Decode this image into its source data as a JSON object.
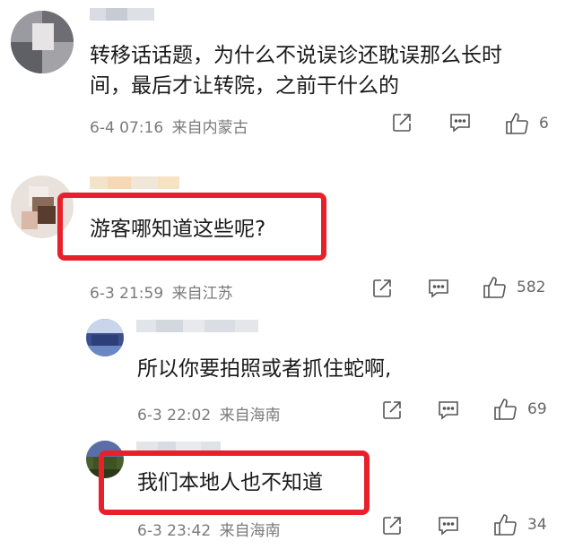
{
  "comments": [
    {
      "text_lines": [
        "转移话话题，为什么不说误诊还耽误那么长时",
        "间，最后才让转院，之前干什么的"
      ],
      "date": "6-4 07:16",
      "location": "来自内蒙古",
      "likes": "6"
    },
    {
      "text_lines": [
        "游客哪知道这些呢?"
      ],
      "date": "6-3 21:59",
      "location": "来自江苏",
      "likes": "582",
      "highlighted": true
    },
    {
      "text_lines": [
        "所以你要拍照或者抓住蛇啊,"
      ],
      "date": "6-3 22:02",
      "location": "来自海南",
      "likes": "69",
      "reply": true
    },
    {
      "text_lines": [
        "我们本地人也不知道"
      ],
      "date": "6-3 23:42",
      "location": "来自海南",
      "likes": "34",
      "reply": true,
      "highlighted": true
    }
  ],
  "icons": [
    "share-icon",
    "comment-icon",
    "like-icon"
  ],
  "colors": {
    "highlight": "#e8202a",
    "meta_text": "#7a7a7a",
    "icon": "#555555"
  }
}
